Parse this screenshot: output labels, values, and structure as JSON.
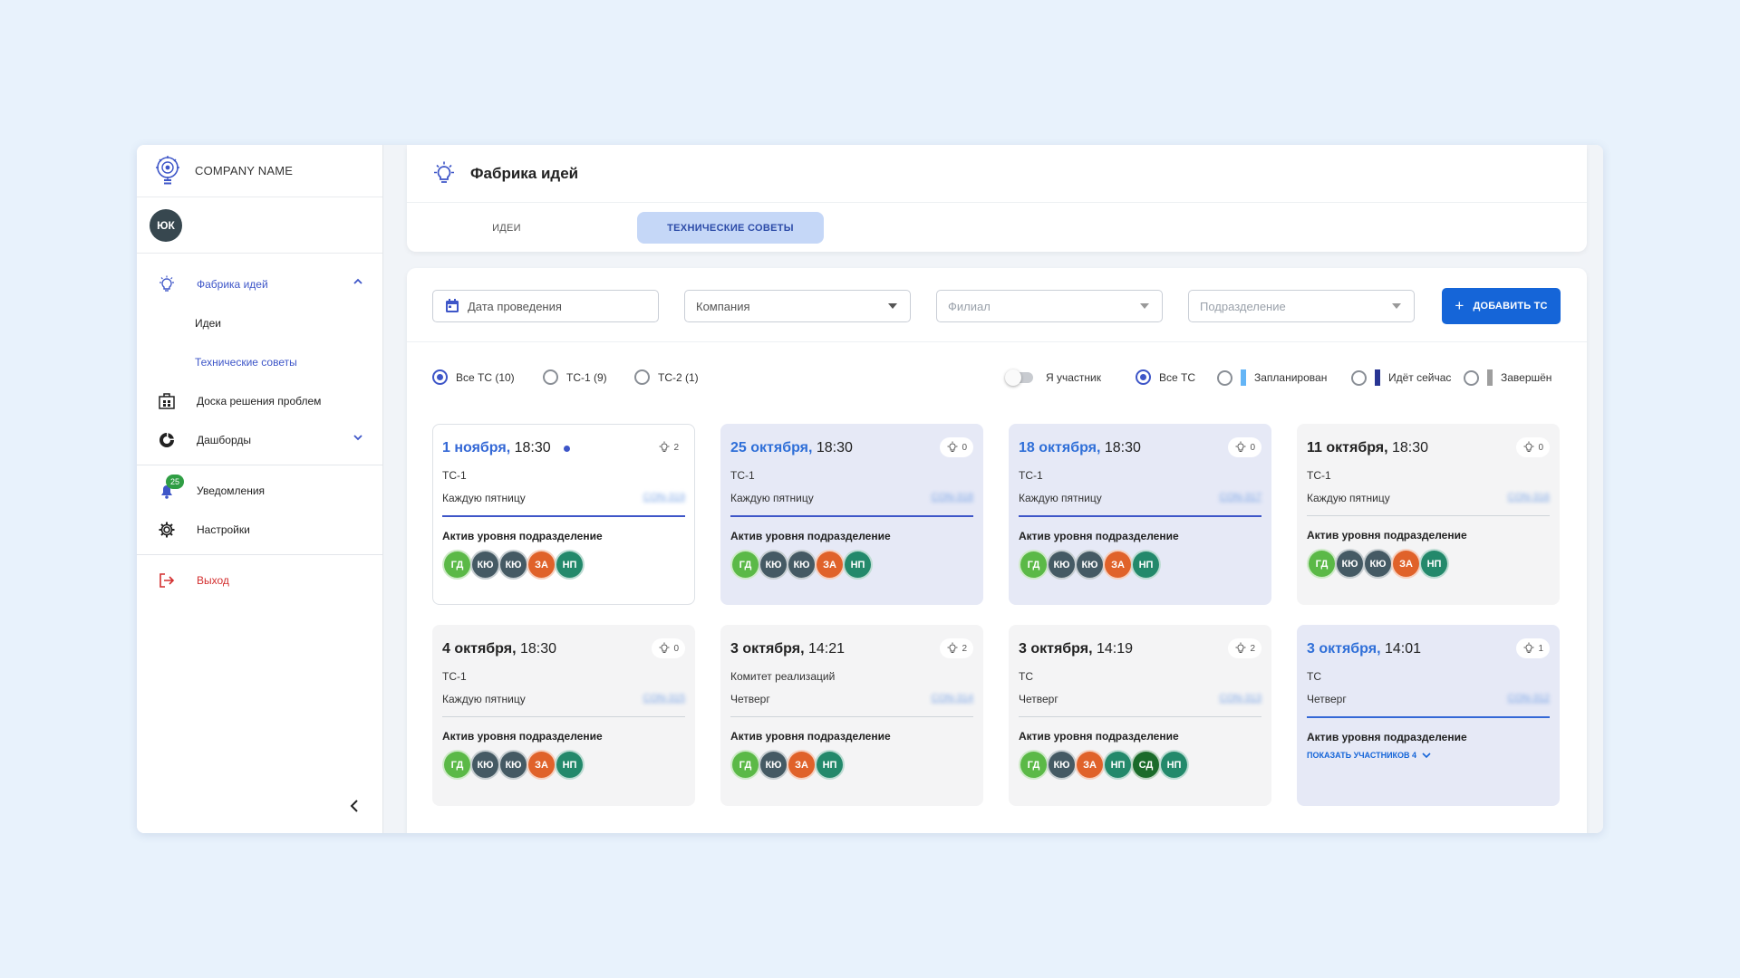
{
  "app": {
    "company_name": "COMPANY NAME",
    "user_initials": "ЮК"
  },
  "sidebar": {
    "items": [
      {
        "label": "Фабрика идей",
        "icon": "lightbulb-icon"
      },
      {
        "label": "Доска решения проблем",
        "icon": "board-icon"
      },
      {
        "label": "Дашборды",
        "icon": "chart-icon"
      },
      {
        "label": "Уведомления",
        "icon": "bell-icon",
        "badge": "25"
      },
      {
        "label": "Настройки",
        "icon": "gear-icon"
      },
      {
        "label": "Выход",
        "icon": "logout-icon"
      }
    ],
    "sub_items": [
      {
        "label": "Идеи"
      },
      {
        "label": "Технические советы"
      }
    ]
  },
  "header": {
    "title": "Фабрика идей",
    "tabs": [
      {
        "label": "ИДЕИ"
      },
      {
        "label": "ТЕХНИЧЕСКИЕ СОВЕТЫ"
      }
    ]
  },
  "filters": {
    "date_placeholder": "Дата проведения",
    "company": "Компания",
    "branch": "Филиал",
    "department": "Подразделение",
    "add_button": "ДОБАВИТЬ ТС"
  },
  "tc_filter": [
    {
      "label": "Все ТС (10)",
      "selected": true
    },
    {
      "label": "ТС-1 (9)",
      "selected": false
    },
    {
      "label": "ТС-2 (1)",
      "selected": false
    }
  ],
  "participant_toggle": "Я участник",
  "status_filter": [
    {
      "label": "Все ТС",
      "selected": true
    },
    {
      "label": "Запланирован",
      "color": "#64b5f6"
    },
    {
      "label": "Идёт сейчас",
      "color": "#283593"
    },
    {
      "label": "Завершён",
      "color": "#9e9e9e"
    }
  ],
  "colors": {
    "accent": "#3e56c8",
    "button": "#1565d8",
    "green": "#5bb947",
    "dark": "#455a64",
    "orange": "#e0622a",
    "teal": "#23896b",
    "darkgreen": "#1b6b2a"
  },
  "cards": [
    {
      "date": "1 ноября,",
      "time": "18:30",
      "ideas": "2",
      "type": "ТС-1",
      "schedule": "Каждую пятницу",
      "link": "CON-319",
      "active": "Актив уровня подразделение",
      "avatars": [
        {
          "t": "ГД",
          "c": "#5bb947"
        },
        {
          "t": "КЮ",
          "c": "#455a64"
        },
        {
          "t": "КЮ",
          "c": "#455a64"
        },
        {
          "t": "ЗА",
          "c": "#e0622a"
        },
        {
          "t": "НП",
          "c": "#23896b"
        }
      ]
    },
    {
      "date": "25 октября,",
      "time": "18:30",
      "ideas": "0",
      "type": "ТС-1",
      "schedule": "Каждую пятницу",
      "link": "CON-318",
      "active": "Актив уровня подразделение",
      "avatars": [
        {
          "t": "ГД",
          "c": "#5bb947"
        },
        {
          "t": "КЮ",
          "c": "#455a64"
        },
        {
          "t": "КЮ",
          "c": "#455a64"
        },
        {
          "t": "ЗА",
          "c": "#e0622a"
        },
        {
          "t": "НП",
          "c": "#23896b"
        }
      ]
    },
    {
      "date": "18 октября,",
      "time": "18:30",
      "ideas": "0",
      "type": "ТС-1",
      "schedule": "Каждую пятницу",
      "link": "CON-317",
      "active": "Актив уровня подразделение",
      "avatars": [
        {
          "t": "ГД",
          "c": "#5bb947"
        },
        {
          "t": "КЮ",
          "c": "#455a64"
        },
        {
          "t": "КЮ",
          "c": "#455a64"
        },
        {
          "t": "ЗА",
          "c": "#e0622a"
        },
        {
          "t": "НП",
          "c": "#23896b"
        }
      ]
    },
    {
      "date": "11 октября,",
      "time": "18:30",
      "ideas": "0",
      "type": "ТС-1",
      "schedule": "Каждую пятницу",
      "link": "CON-316",
      "active": "Актив уровня подразделение",
      "avatars": [
        {
          "t": "ГД",
          "c": "#5bb947"
        },
        {
          "t": "КЮ",
          "c": "#455a64"
        },
        {
          "t": "КЮ",
          "c": "#455a64"
        },
        {
          "t": "ЗА",
          "c": "#e0622a"
        },
        {
          "t": "НП",
          "c": "#23896b"
        }
      ]
    },
    {
      "date": "4 октября,",
      "time": "18:30",
      "ideas": "0",
      "type": "ТС-1",
      "schedule": "Каждую пятницу",
      "link": "CON-315",
      "active": "Актив уровня подразделение",
      "avatars": [
        {
          "t": "ГД",
          "c": "#5bb947"
        },
        {
          "t": "КЮ",
          "c": "#455a64"
        },
        {
          "t": "КЮ",
          "c": "#455a64"
        },
        {
          "t": "ЗА",
          "c": "#e0622a"
        },
        {
          "t": "НП",
          "c": "#23896b"
        }
      ]
    },
    {
      "date": "3 октября,",
      "time": "14:21",
      "ideas": "2",
      "type": "Комитет реализаций",
      "schedule": "Четверг",
      "link": "CON-314",
      "active": "Актив уровня подразделение",
      "avatars": [
        {
          "t": "ГД",
          "c": "#5bb947"
        },
        {
          "t": "КЮ",
          "c": "#455a64"
        },
        {
          "t": "ЗА",
          "c": "#e0622a"
        },
        {
          "t": "НП",
          "c": "#23896b"
        }
      ]
    },
    {
      "date": "3 октября,",
      "time": "14:19",
      "ideas": "2",
      "type": "ТС",
      "schedule": "Четверг",
      "link": "CON-313",
      "active": "Актив уровня подразделение",
      "avatars": [
        {
          "t": "ГД",
          "c": "#5bb947"
        },
        {
          "t": "КЮ",
          "c": "#455a64"
        },
        {
          "t": "ЗА",
          "c": "#e0622a"
        },
        {
          "t": "НП",
          "c": "#23896b"
        },
        {
          "t": "СД",
          "c": "#1b6b2a"
        },
        {
          "t": "НП",
          "c": "#23896b"
        }
      ]
    },
    {
      "date": "3 октября,",
      "time": "14:01",
      "ideas": "1",
      "type": "ТС",
      "schedule": "Четверг",
      "link": "CON-312",
      "active": "Актив уровня подразделение",
      "show_more": "ПОКАЗАТЬ УЧАСТНИКОВ 4"
    }
  ]
}
